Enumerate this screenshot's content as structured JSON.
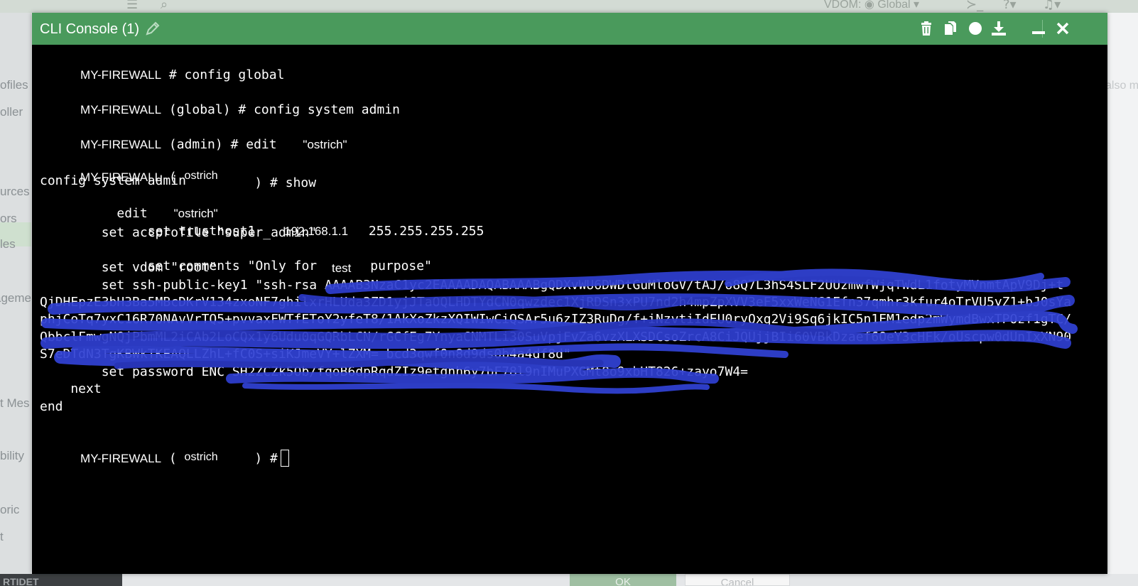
{
  "background": {
    "topbar": {
      "vdom_label": "VDOM:",
      "vdom_value": "Global"
    },
    "sidebar_items": [
      "ofiles",
      "oller",
      "urces",
      "ors",
      "les",
      "ageme",
      "t Mes",
      "bility",
      "oric",
      "t"
    ],
    "right_text": "also m",
    "footer": {
      "logo": "RTIDET",
      "ok_label": "OK",
      "cancel_label": "Cancel"
    }
  },
  "window": {
    "title": "CLI Console (1)",
    "icons": [
      "trash-icon",
      "copy-icon",
      "circle-icon",
      "download-icon",
      "minimize-icon",
      "close-icon"
    ]
  },
  "terminal": {
    "lines": [
      {
        "prompt": "MY-FIREWALL",
        "text": " # config global"
      },
      {
        "prompt": "MY-FIREWALL",
        "text": " (global) # config system admin"
      },
      {
        "prompt": "MY-FIREWALL",
        "text": " (admin) # edit ",
        "arg": "\"ostrich\""
      },
      {
        "prompt": "MY-FIREWALL",
        "text_open": " ( ",
        "name": "ostrich",
        "text_close": " ) # show"
      }
    ],
    "show_output": {
      "l1": "config system admin",
      "l2_cmd": "    edit ",
      "l2_arg": "\"ostrich\"",
      "l3_cmd": "        set trusthost1 ",
      "l3_ip": "192.168.1.1",
      "l3_mask": " 255.255.255.255",
      "l4": "        set accprofile \"super_admin\"",
      "l5_a": "        set comments \"Only for ",
      "l5_b": "test",
      "l5_c": " purpose\"",
      "l6": "        set vdom \"root\"",
      "l7": "        set ssh-public-key1 \"ssh-rsa AAAAB3NzaC1yc2EAAAADAQABAAABgQDXvWU6DWDtGuMloGV/tAJ/o8Q7L3hS4SLF2UUzmwfWjqTWdL1fotyMVnmtApV9Dj+t",
      "l8": "QjDHEpzE3bH3Ba5MBcDKrV134zxoNF7ghilxrHLUda3ZD1yjJTaOQLHDTYdCN0qwzdec1XjRDSn3xPU7nd2h4mpZpXVV3eF5xxWeNG1Efn37qmhr3kfur4oTrVU5yZ1+bJ0sYa",
      "l9": "phjCoTq7yxC16R70NAvVrTQ5+pvvaxFWTfEToY2yfeT8/1AkXoZkzXQIWIwCiQSAr5u6zIZ3RuDg/f+iNzvtiIdEU0ryOxq2Vi9Sq6jkIC5n1EM1edp2mWymdBwxTPOzf1gTC/",
      "l10": "QbbclFmwgNQjPbmML2iCAb2LoCQx1y6Udu0qGQRbLCN/rGCfEg7YnyaCNMTLi30SuVpjFvZa6vzXLXSDCsoZrcA8CiJQUjjBIi60VBkDzaef6OeY3cHFk/oUscpw0dUnIxXN90",
      "l11": "S7eDTdN3TgKBWkTKEAQLLZhL+fC0S+siKJmeVY+lZXM= bcd3qwf0n8d9ds0b4a4df8d\"",
      "l12": "        set password ENC SH2ZCZk5Ob/fqoB6dpRqdZIz9etgnh6y7bF78l9nIMuPXGMt8o9xbHT826+zayo7W4=",
      "l13": "    next",
      "l14": "end"
    },
    "final_prompt": {
      "prompt": "MY-FIREWALL",
      "text_open": " ( ",
      "name": "ostrich",
      "text_close": " ) #"
    }
  },
  "colors": {
    "titlebar": "#4a9a5c",
    "terminal_bg": "#000000",
    "redaction": "#2f3fd0"
  }
}
